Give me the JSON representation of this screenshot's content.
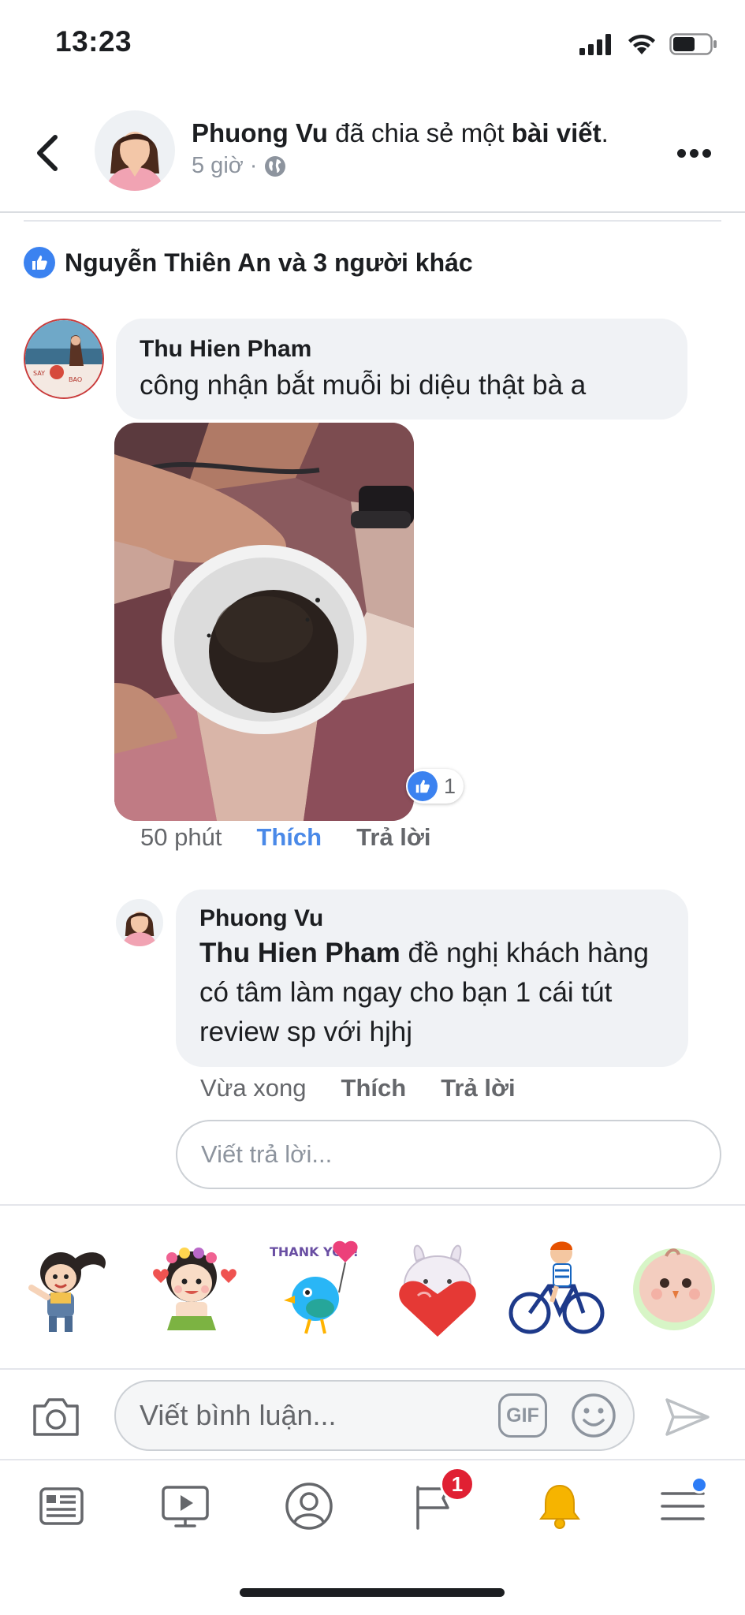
{
  "status_bar": {
    "time": "13:23"
  },
  "post_header": {
    "author": "Phuong Vu",
    "action": " đã chia sẻ một ",
    "object": "bài viết",
    "period": ".",
    "time": "5 giờ",
    "separator": "·"
  },
  "reactions": {
    "summary": "Nguyễn Thiên An và 3 người khác"
  },
  "comment": {
    "author": "Thu Hien Pham",
    "text": "công nhận bắt muỗi bi diệu thật bà a",
    "photo_likes": "1",
    "time": "50 phút",
    "like_label": "Thích",
    "reply_label": "Trả lời"
  },
  "reply": {
    "author": "Phuong Vu",
    "mention": "Thu Hien Pham",
    "text": " đề nghị khách hàng có tâm làm ngay cho bạn 1 cái tút review sp với hjhj",
    "time": "Vừa xong",
    "like_label": "Thích",
    "reply_label": "Trả lời"
  },
  "reply_input": {
    "placeholder": "Viết trả lời..."
  },
  "composer": {
    "placeholder": "Viết bình luận...",
    "gif_label": "GIF"
  },
  "stickers": [
    "girl-waving-sticker",
    "flower-girl-sticker",
    "thank-you-bird-sticker",
    "bunny-heart-sticker",
    "cyclist-sticker",
    "chick-sticker"
  ],
  "sticker_text": {
    "thank_you": "THANK YOU!"
  },
  "tabbar": {
    "items": [
      "news-feed-icon",
      "watch-icon",
      "profile-icon",
      "pages-icon",
      "notifications-icon",
      "menu-icon"
    ],
    "pages_badge": "1"
  },
  "colors": {
    "accent": "#4a89e8",
    "like_blue": "#3b82f0",
    "badge_red": "#e02033",
    "bubble_bg": "#f0f2f5",
    "muted": "#65676b"
  }
}
